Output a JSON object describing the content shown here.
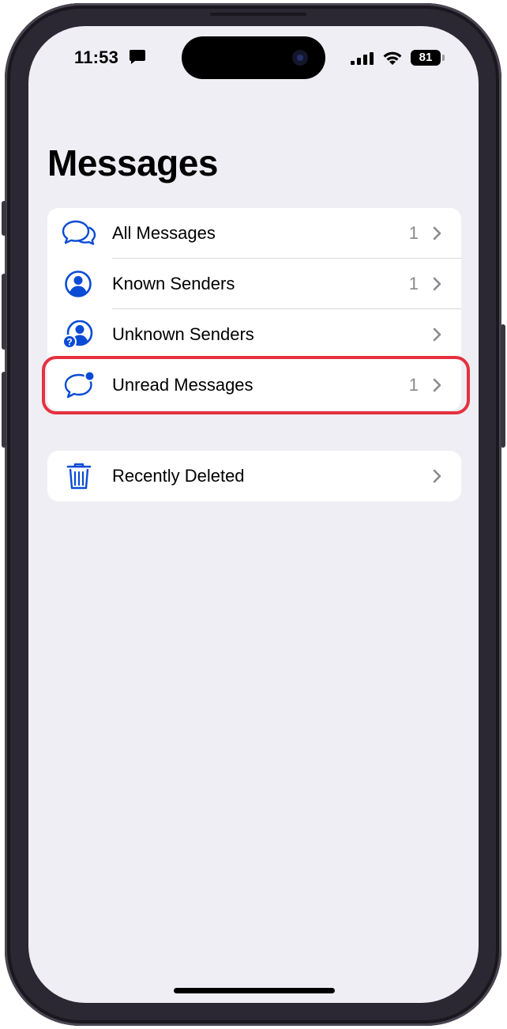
{
  "status_bar": {
    "time": "11:53",
    "battery": "81"
  },
  "page_title": "Messages",
  "filters": [
    {
      "label": "All Messages",
      "count": "1",
      "icon": "chat-bubbles-icon"
    },
    {
      "label": "Known Senders",
      "count": "1",
      "icon": "person-circle-icon"
    },
    {
      "label": "Unknown Senders",
      "count": "",
      "icon": "person-question-icon"
    },
    {
      "label": "Unread Messages",
      "count": "1",
      "icon": "chat-bubble-unread-icon",
      "highlighted": true
    }
  ],
  "other": [
    {
      "label": "Recently Deleted",
      "icon": "trash-icon"
    }
  ],
  "colors": {
    "accent": "#0a4bd6",
    "highlight": "#e5313f",
    "background": "#efeef4"
  }
}
